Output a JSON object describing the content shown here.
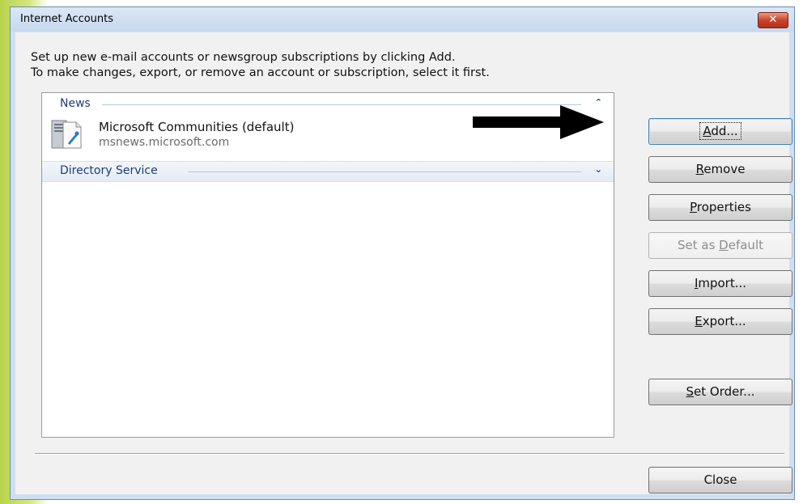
{
  "window": {
    "title": "Internet Accounts",
    "close_glyph": "✕"
  },
  "instructions": {
    "line1": "Set up new e-mail accounts or newsgroup subscriptions by clicking Add.",
    "line2": "To make changes, export, or remove an account or subscription, select it first."
  },
  "list": {
    "groups": [
      {
        "label": "News",
        "state": "expanded",
        "chevron": "⌃"
      },
      {
        "label": "Directory Service",
        "state": "collapsed",
        "chevron": "⌄"
      }
    ],
    "accounts": [
      {
        "name": "Microsoft Communities (default)",
        "server": "msnews.microsoft.com",
        "icon": "news-server-icon"
      }
    ]
  },
  "buttons": {
    "add": {
      "pre": "",
      "mnemonic": "A",
      "post": "dd..."
    },
    "remove": {
      "pre": "",
      "mnemonic": "R",
      "post": "emove"
    },
    "properties": {
      "pre": "",
      "mnemonic": "P",
      "post": "roperties"
    },
    "set_default": {
      "pre": "Set as ",
      "mnemonic": "D",
      "post": "efault"
    },
    "import": {
      "pre": "",
      "mnemonic": "I",
      "post": "mport..."
    },
    "export": {
      "pre": "",
      "mnemonic": "E",
      "post": "xport..."
    },
    "set_order": {
      "pre": "",
      "mnemonic": "S",
      "post": "et Order..."
    },
    "close": {
      "label": "Close"
    }
  },
  "colors": {
    "group_header_text": "#1e3d7a",
    "title_close": "#c9432b"
  }
}
